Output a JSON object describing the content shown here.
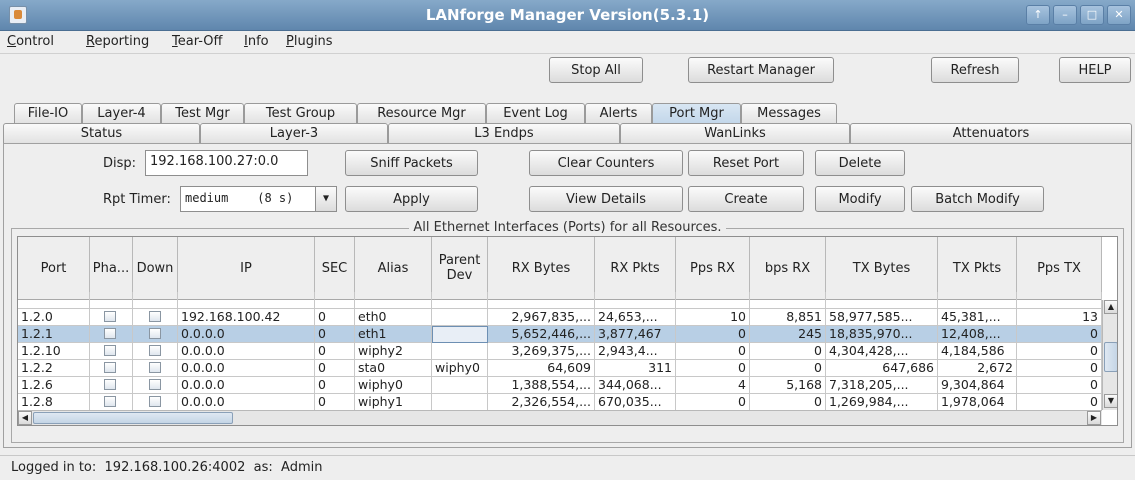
{
  "window": {
    "title": "LANforge Manager   Version(5.3.1)",
    "controls": [
      "↑",
      "–",
      "□",
      "✕"
    ]
  },
  "menu": [
    {
      "label": "Control",
      "u": "C",
      "rest": "ontrol"
    },
    {
      "label": "Reporting",
      "u": "R",
      "rest": "eporting"
    },
    {
      "label": "Tear-Off",
      "u": "T",
      "rest": "ear-Off"
    },
    {
      "label": "Info",
      "u": "I",
      "rest": "nfo"
    },
    {
      "label": "Plugins",
      "u": "P",
      "rest": "lugins"
    }
  ],
  "toolbar": {
    "stop_all": "Stop All",
    "restart": "Restart Manager",
    "refresh": "Refresh",
    "help": "HELP"
  },
  "tabs_row1": [
    "File-IO",
    "Layer-4",
    "Test Mgr",
    "Test Group",
    "Resource Mgr",
    "Event Log",
    "Alerts",
    "Port Mgr",
    "Messages"
  ],
  "tabs_row2": [
    "Status",
    "Layer-3",
    "L3 Endps",
    "WanLinks",
    "Attenuators"
  ],
  "selected_tab": "Port Mgr",
  "controls": {
    "disp_label": "Disp:",
    "disp_value": "192.168.100.27:0.0",
    "rpt_label": "Rpt Timer:",
    "rpt_value": "medium    (8 s)",
    "sniff": "Sniff Packets",
    "apply": "Apply",
    "clear_counters": "Clear Counters",
    "reset_port": "Reset Port",
    "delete": "Delete",
    "view_details": "View Details",
    "create": "Create",
    "modify": "Modify",
    "batch_modify": "Batch Modify"
  },
  "group_title": "All Ethernet Interfaces (Ports) for all Resources.",
  "table": {
    "headers": [
      "Port",
      "Pha...",
      "Down",
      "IP",
      "SEC",
      "Alias",
      "Parent Dev",
      "RX Bytes",
      "RX Pkts",
      "Pps RX",
      "bps RX",
      "TX Bytes",
      "TX Pkts",
      "Pps TX"
    ],
    "rows": [
      {
        "port": "1.2.0",
        "ip": "192.168.100.42",
        "sec": "0",
        "alias": "eth0",
        "parent": "",
        "rx_bytes": "2,967,835,...",
        "rx_pkts": "24,653,...",
        "pps_rx": "10",
        "bps_rx": "8,851",
        "tx_bytes": "58,977,585...",
        "tx_pkts": "45,381,...",
        "pps_tx": "13"
      },
      {
        "port": "1.2.1",
        "ip": "0.0.0.0",
        "sec": "0",
        "alias": "eth1",
        "parent": "",
        "rx_bytes": "5,652,446,...",
        "rx_pkts": "3,877,467",
        "pps_rx": "0",
        "bps_rx": "245",
        "tx_bytes": "18,835,970...",
        "tx_pkts": "12,408,...",
        "pps_tx": "0"
      },
      {
        "port": "1.2.10",
        "ip": "0.0.0.0",
        "sec": "0",
        "alias": "wiphy2",
        "parent": "",
        "rx_bytes": "3,269,375,...",
        "rx_pkts": "2,943,4...",
        "pps_rx": "0",
        "bps_rx": "0",
        "tx_bytes": "4,304,428,...",
        "tx_pkts": "4,184,586",
        "pps_tx": "0"
      },
      {
        "port": "1.2.2",
        "ip": "0.0.0.0",
        "sec": "0",
        "alias": "sta0",
        "parent": "wiphy0",
        "rx_bytes": "64,609",
        "rx_pkts": "311",
        "pps_rx": "0",
        "bps_rx": "0",
        "tx_bytes": "647,686",
        "tx_pkts": "2,672",
        "pps_tx": "0"
      },
      {
        "port": "1.2.6",
        "ip": "0.0.0.0",
        "sec": "0",
        "alias": "wiphy0",
        "parent": "",
        "rx_bytes": "1,388,554,...",
        "rx_pkts": "344,068...",
        "pps_rx": "4",
        "bps_rx": "5,168",
        "tx_bytes": "7,318,205,...",
        "tx_pkts": "9,304,864",
        "pps_tx": "0"
      },
      {
        "port": "1.2.8",
        "ip": "0.0.0.0",
        "sec": "0",
        "alias": "wiphy1",
        "parent": "",
        "rx_bytes": "2,326,554,...",
        "rx_pkts": "670,035...",
        "pps_rx": "0",
        "bps_rx": "0",
        "tx_bytes": "1,269,984,...",
        "tx_pkts": "1,978,064",
        "pps_tx": "0"
      }
    ],
    "selected_row": "1.2.1"
  },
  "status": "Logged in to:  192.168.100.26:4002  as:  Admin"
}
